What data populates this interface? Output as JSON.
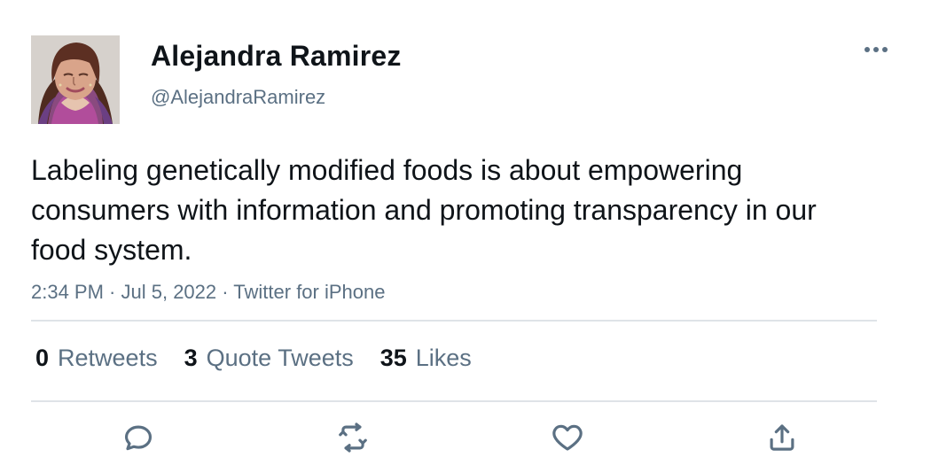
{
  "author": {
    "name": "Alejandra Ramirez",
    "handle": "@AlejandraRamirez",
    "avatar_icon": "profile-photo"
  },
  "tweet": {
    "text": "Labeling genetically modified foods is about empowering consumers with information and promoting transparency in our food system.",
    "time": "2:34 PM",
    "date": "Jul 5, 2022",
    "source": "Twitter for iPhone",
    "separator": " · "
  },
  "stats": {
    "retweets_count": "0",
    "retweets_label": "Retweets",
    "quote_tweets_count": "3",
    "quote_tweets_label": "Quote Tweets",
    "likes_count": "35",
    "likes_label": "Likes"
  },
  "actions": {
    "reply_icon": "comment-icon",
    "retweet_icon": "retweet-icon",
    "like_icon": "heart-icon",
    "share_icon": "share-icon"
  },
  "colors": {
    "text_primary": "#0f1419",
    "text_secondary": "#5b7083",
    "divider": "#dfe3e8",
    "background": "#ffffff"
  }
}
